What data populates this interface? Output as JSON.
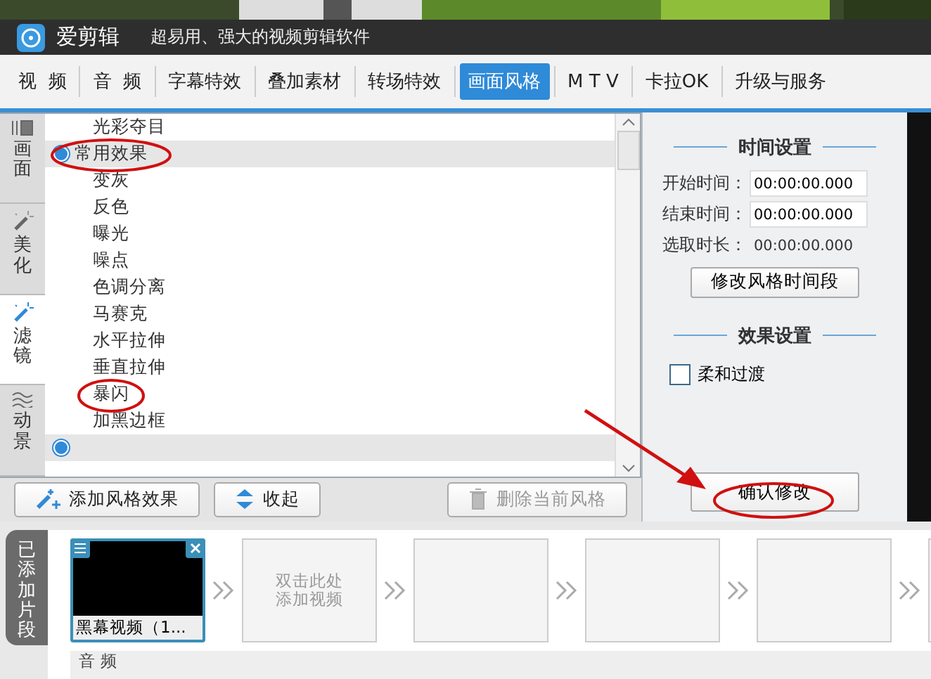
{
  "app": {
    "name": "爱剪辑",
    "slogan": "超易用、强大的视频剪辑软件"
  },
  "tabs": [
    {
      "label": "视  频",
      "selected": false
    },
    {
      "label": "音  频",
      "selected": false
    },
    {
      "label": "字幕特效",
      "selected": false
    },
    {
      "label": "叠加素材",
      "selected": false
    },
    {
      "label": "转场特效",
      "selected": false
    },
    {
      "label": "画面风格",
      "selected": true
    },
    {
      "label": "M T V",
      "selected": false
    },
    {
      "label": "卡拉OK",
      "selected": false
    },
    {
      "label": "升级与服务",
      "selected": false
    }
  ],
  "side_tabs": [
    {
      "label": "画面",
      "selected": false
    },
    {
      "label": "美化",
      "selected": false
    },
    {
      "label": "滤镜",
      "selected": true
    },
    {
      "label": "动景",
      "selected": false
    }
  ],
  "effects": [
    {
      "kind": "item",
      "label": "光彩夺目"
    },
    {
      "kind": "group",
      "label": "常用效果"
    },
    {
      "kind": "item",
      "label": "变灰"
    },
    {
      "kind": "item",
      "label": "反色"
    },
    {
      "kind": "item",
      "label": "曝光"
    },
    {
      "kind": "item",
      "label": "噪点"
    },
    {
      "kind": "item",
      "label": "色调分离"
    },
    {
      "kind": "item",
      "label": "马赛克"
    },
    {
      "kind": "item",
      "label": "水平拉伸"
    },
    {
      "kind": "item",
      "label": "垂直拉伸"
    },
    {
      "kind": "item",
      "label": "暴闪"
    },
    {
      "kind": "item",
      "label": "加黑边框"
    },
    {
      "kind": "group"
    }
  ],
  "buttons": [
    {
      "label": "添加风格效果",
      "disabled": false
    },
    {
      "label": "收起",
      "disabled": false
    },
    {
      "label": "删除当前风格",
      "disabled": true
    }
  ],
  "time_settings": {
    "title": "时间设置",
    "fields": [
      {
        "label": "开始时间：",
        "value": "00:00:00.000",
        "kind": "input"
      },
      {
        "label": "结束时间：",
        "value": "00:00:00.000",
        "kind": "input"
      },
      {
        "label": "选取时长：",
        "value": "00:00:00.000",
        "kind": "text"
      }
    ],
    "button": "修改风格时间段"
  },
  "effect_settings": {
    "title": "效果设置",
    "options": [
      {
        "label": "柔和过渡",
        "checked": false
      }
    ]
  },
  "confirm_button": "确认修改",
  "timeline": {
    "tab": "已添加片段",
    "clips": [
      {
        "kind": "video",
        "label": "黑幕视频（1...",
        "selected": true
      },
      {
        "kind": "empty",
        "hint": "双击此处添加视频"
      },
      {
        "kind": "empty"
      },
      {
        "kind": "empty"
      },
      {
        "kind": "empty"
      },
      {
        "kind": "empty"
      }
    ],
    "audio_label": "音 频"
  }
}
